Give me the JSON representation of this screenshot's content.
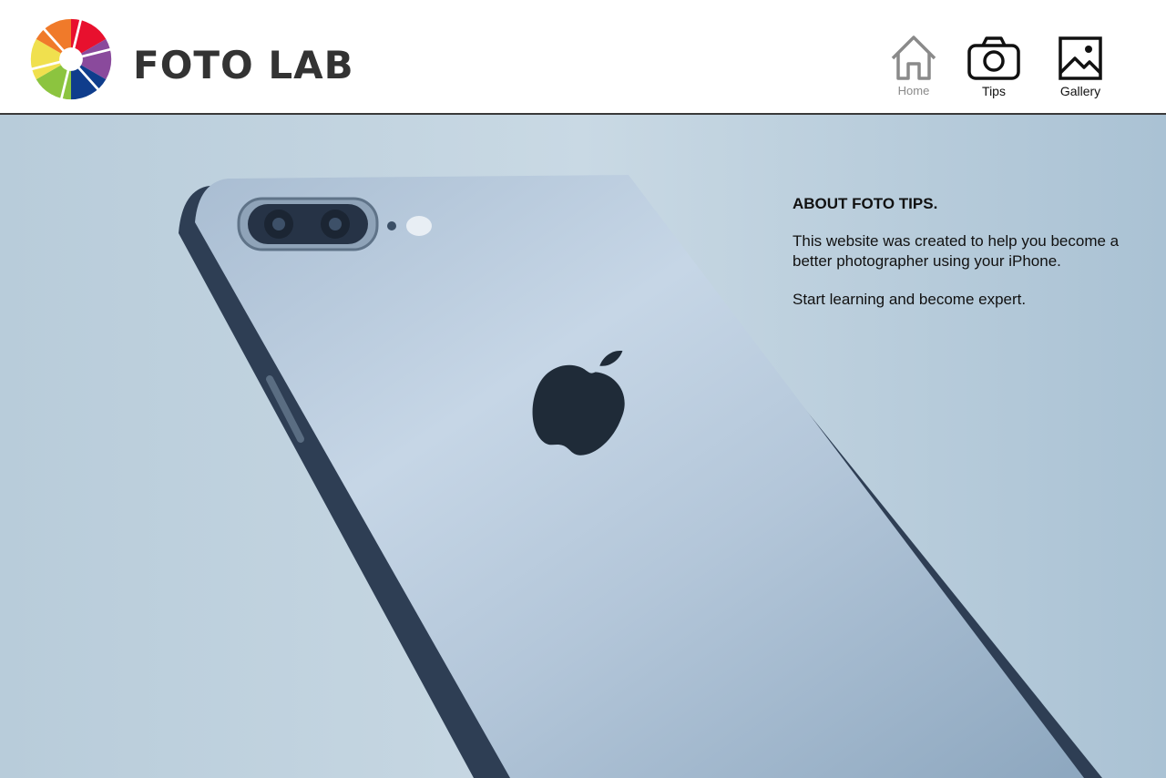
{
  "header": {
    "brand": "FOTO LAB",
    "logo_icon": "aperture-logo-icon",
    "nav": [
      {
        "label": "Home",
        "icon": "home-icon"
      },
      {
        "label": "Tips",
        "icon": "camera-icon"
      },
      {
        "label": "Gallery",
        "icon": "image-icon"
      }
    ]
  },
  "hero": {
    "image": "iphone-back-photo",
    "title": "ABOUT FOTO TIPS.",
    "paragraph1": "This website was created to help you become a better photographer using your iPhone.",
    "paragraph2": "Start learning and become expert."
  },
  "colors": {
    "aperture": [
      "#e8102e",
      "#8a4a9c",
      "#0f3d8c",
      "#8cc43f",
      "#f0e04e",
      "#f07a2a"
    ],
    "text": "#111111",
    "brand": "#333333"
  }
}
